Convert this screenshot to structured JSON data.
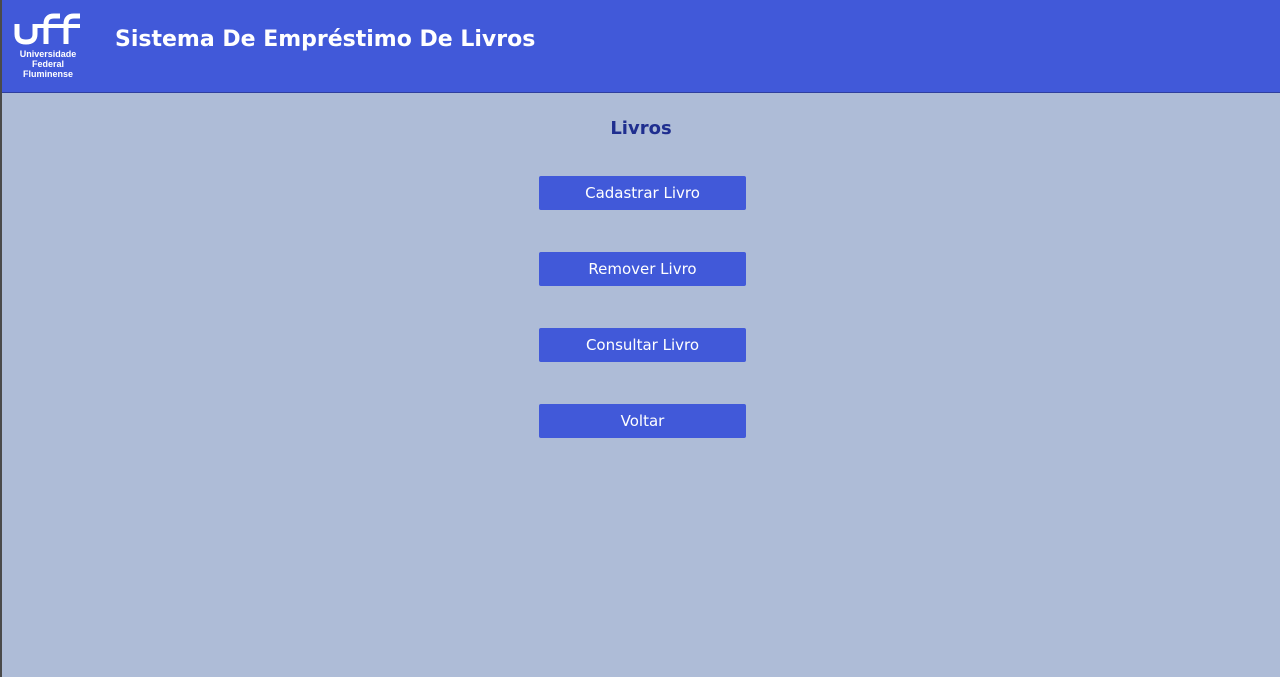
{
  "header": {
    "logo": {
      "mark": "uff",
      "lines": [
        "Universidade",
        "Federal",
        "Fluminense"
      ]
    },
    "title": "Sistema De Empréstimo De Livros"
  },
  "main": {
    "title": "Livros",
    "buttons": [
      {
        "label": "Cadastrar Livro"
      },
      {
        "label": "Remover Livro"
      },
      {
        "label": "Consultar Livro"
      },
      {
        "label": "Voltar"
      }
    ]
  },
  "colors": {
    "header_bg": "#4159d9",
    "page_bg": "#aebcd7",
    "button_bg": "#4159d9",
    "section_title": "#1f2e8f"
  }
}
